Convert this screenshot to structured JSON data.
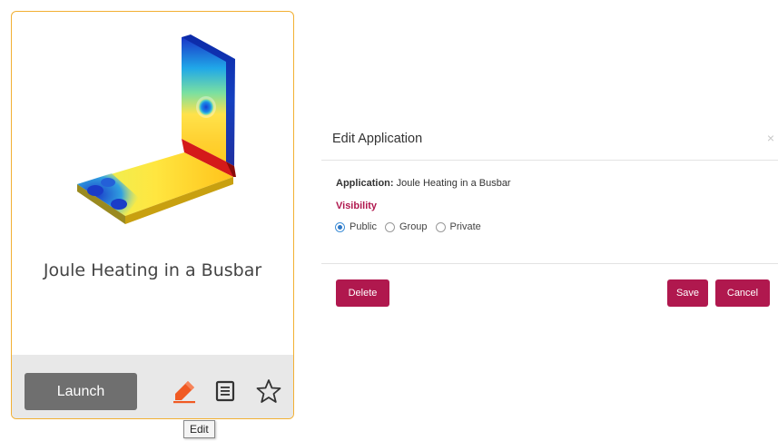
{
  "app_card": {
    "title": "Joule Heating in a Busbar",
    "launch_label": "Launch",
    "tooltip": "Edit",
    "icons": [
      "edit-pencil-icon",
      "document-icon",
      "star-icon"
    ]
  },
  "dialog": {
    "title": "Edit Application",
    "close_glyph": "×",
    "application_label": "Application:",
    "application_name": "Joule Heating in a Busbar",
    "visibility_label": "Visibility",
    "visibility_options": [
      "Public",
      "Group",
      "Private"
    ],
    "visibility_selected": "Public",
    "delete_label": "Delete",
    "save_label": "Save",
    "cancel_label": "Cancel"
  },
  "colors": {
    "card_border": "#f2b033",
    "accent": "#b0184e",
    "launch_button": "#6f6f6f",
    "edit_icon": "#f05a23"
  }
}
